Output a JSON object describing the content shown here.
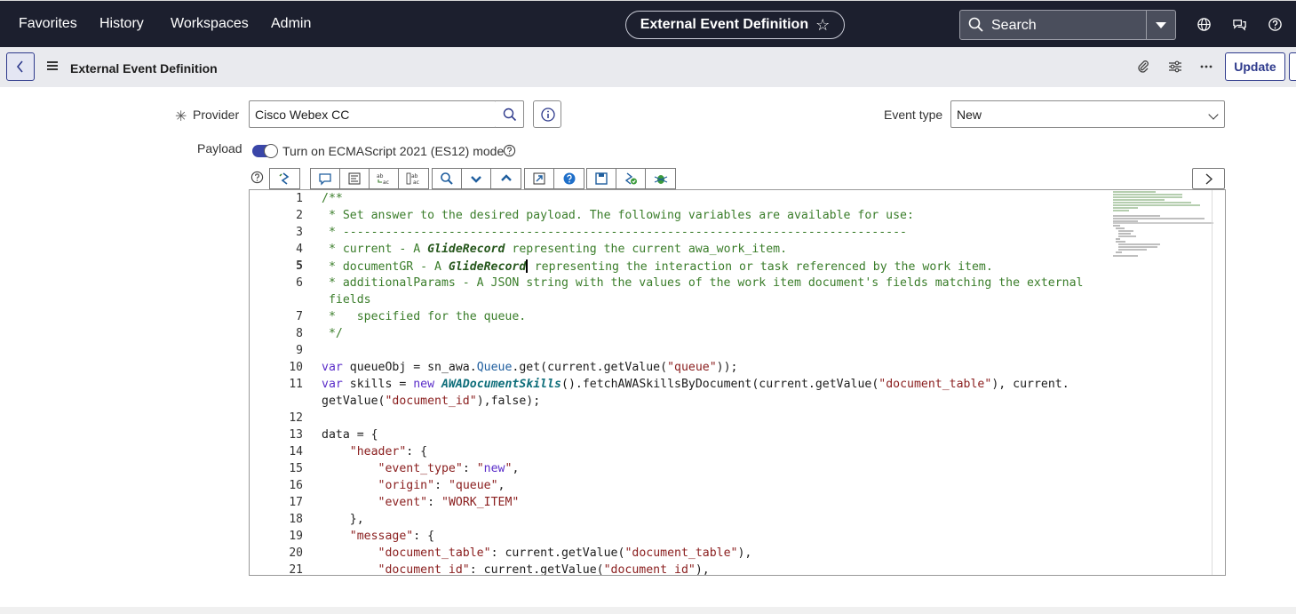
{
  "topnav": {
    "menus": [
      "Favorites",
      "History",
      "Workspaces",
      "Admin"
    ],
    "title": "External Event Definition",
    "search_placeholder": "Search"
  },
  "subheader": {
    "title": "External Event Definition",
    "update_label": "Update"
  },
  "form": {
    "provider_label": "Provider",
    "provider_value": "Cisco Webex CC",
    "event_type_label": "Event type",
    "event_type_value": "New",
    "payload_label": "Payload",
    "es_mode_label": "Turn on ECMAScript 2021 (ES12) mode"
  },
  "editor": {
    "line_numbers": [
      "1",
      "2",
      "3",
      "4",
      "5",
      "6",
      "",
      "7",
      "8",
      "9",
      "10",
      "11",
      "",
      "12",
      "13",
      "14",
      "15",
      "16",
      "17",
      "18",
      "19",
      "20",
      "21"
    ],
    "lines": [
      "/**",
      " * Set answer to the desired payload. The following variables are available for use:",
      " * --------------------------------------------------------------------------------",
      " * current - A GlideRecord representing the current awa_work_item.",
      " * documentGR - A GlideRecord representing the interaction or task referenced by the work item.",
      " * additionalParams - A JSON string with the values of the work item document's fields matching the external",
      " fields",
      " *   specified for the queue.",
      " */",
      "",
      "var queueObj = sn_awa.Queue.get(current.getValue(\"queue\"));",
      "var skills = new AWADocumentSkills().fetchAWASkillsByDocument(current.getValue(\"document_table\"), current.",
      "getValue(\"document_id\"),false);",
      "",
      "data = {",
      "    \"header\": {",
      "        \"event_type\": \"new\",",
      "        \"origin\": \"queue\",",
      "        \"event\": \"WORK_ITEM\"",
      "    },",
      "    \"message\": {",
      "        \"document_table\": current.getValue(\"document_table\"),",
      "        \"document_id\": current.getValue(\"document_id\"),"
    ]
  }
}
